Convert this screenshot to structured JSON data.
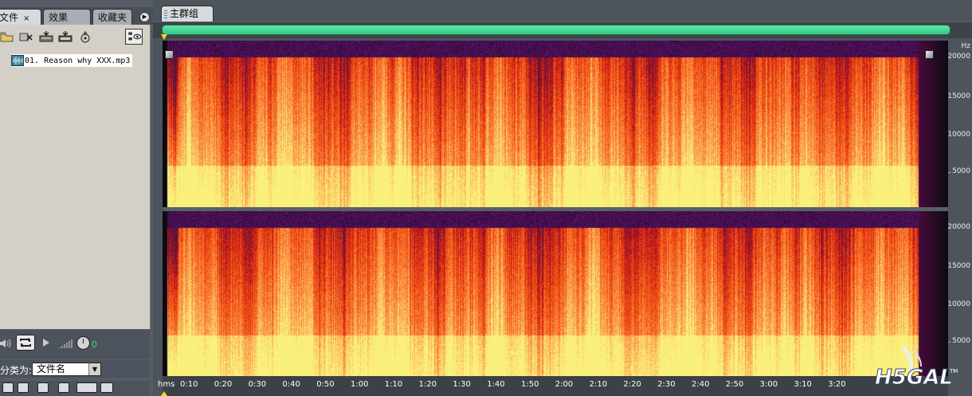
{
  "left_panel": {
    "tabs": [
      {
        "label": "文件",
        "close": "×"
      },
      {
        "label": "效果"
      },
      {
        "label": "收藏夹"
      }
    ],
    "toolbar_icons": [
      "open-file-icon",
      "close-file-icon",
      "insert-multitrack-icon",
      "insert-cd-icon",
      "edit-file-icon",
      "view-options-icon"
    ],
    "files": [
      {
        "name": "01. Reason why XXX.mp3",
        "icon": "audio-file-icon"
      }
    ],
    "sort_label": "分类为:",
    "sort_value": "文件名",
    "volume_value": "0"
  },
  "main_panel": {
    "tab_label": "主群组",
    "colors": {
      "overview": "#3fd893",
      "marker": "#ffd21f"
    },
    "frequency_unit": "Hz",
    "frequency_labels": [
      "20000",
      "15000",
      "10000",
      "5000"
    ],
    "time_labels": [
      "hms",
      "0:10",
      "0:20",
      "0:30",
      "0:40",
      "0:50",
      "1:00",
      "1:10",
      "1:20",
      "1:30",
      "1:40",
      "1:50",
      "2:00",
      "2:10",
      "2:20",
      "2:30",
      "2:40",
      "2:50",
      "3:00",
      "3:10",
      "3:20"
    ],
    "view": "spectral frequency display",
    "channels": 2
  },
  "watermark": {
    "text": "H5GAL",
    "tm": "TM"
  }
}
